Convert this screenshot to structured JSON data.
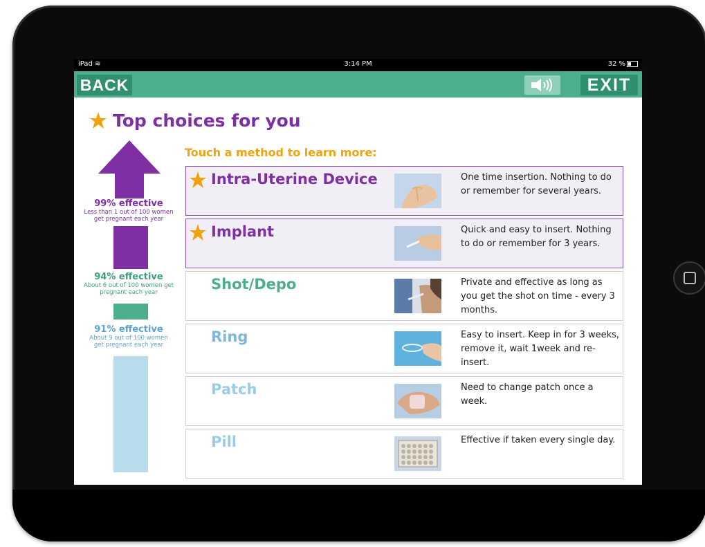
{
  "status_bar": {
    "device": "iPad",
    "time": "3:14 PM",
    "battery": "32 %"
  },
  "nav": {
    "back_label": "BACK",
    "exit_label": "EXIT"
  },
  "page": {
    "title": "Top choices for you",
    "subtitle": "Touch a method to learn more:"
  },
  "effectiveness": [
    {
      "percent": "99% effective",
      "description_line1": "Less than 1 out of 100 women",
      "description_line2": "get pregnant each year",
      "color": "#7d2fa3"
    },
    {
      "percent": "94% effective",
      "description_line1": "About 6 out of 100 women get",
      "description_line2": "pregnant each year",
      "color": "#3f9e7e"
    },
    {
      "percent": "91% effective",
      "description_line1": "About 9 out of 100 women",
      "description_line2": "get pregnant each year",
      "color": "#5fa5cf"
    }
  ],
  "methods": [
    {
      "name": "Intra-Uterine Device",
      "description": "One time insertion. Nothing to do or remember for several years.",
      "top_choice": true,
      "name_color": "#7d2fa3",
      "icon": "iud-in-hand-photo"
    },
    {
      "name": "Implant",
      "description": "Quick and easy to insert. Nothing to do or remember for 3 years.",
      "top_choice": true,
      "name_color": "#7d2fa3",
      "icon": "implant-rod-photo"
    },
    {
      "name": "Shot/Depo",
      "description": "Private and effective as long as you get the shot on time - every 3 months.",
      "top_choice": false,
      "name_color": "#4dae8c",
      "icon": "injection-photo"
    },
    {
      "name": "Ring",
      "description": "Easy to insert. Keep in for 3 weeks, remove it, wait 1week and re-insert.",
      "top_choice": false,
      "name_color": "#7cb7dd",
      "icon": "vaginal-ring-photo"
    },
    {
      "name": "Patch",
      "description": "Need to change patch once a week.",
      "top_choice": false,
      "name_color": "#9ccbe6",
      "icon": "patch-photo"
    },
    {
      "name": "Pill",
      "description": "Effective if taken every single day.",
      "top_choice": false,
      "name_color": "#9ccbe6",
      "icon": "pill-pack-photo"
    }
  ],
  "colors": {
    "accent_green": "#4dae8c",
    "dark_green": "#2f8f6f",
    "purple": "#7d2fa3",
    "orange": "#f0a30e",
    "light_blue": "#b9dced"
  }
}
